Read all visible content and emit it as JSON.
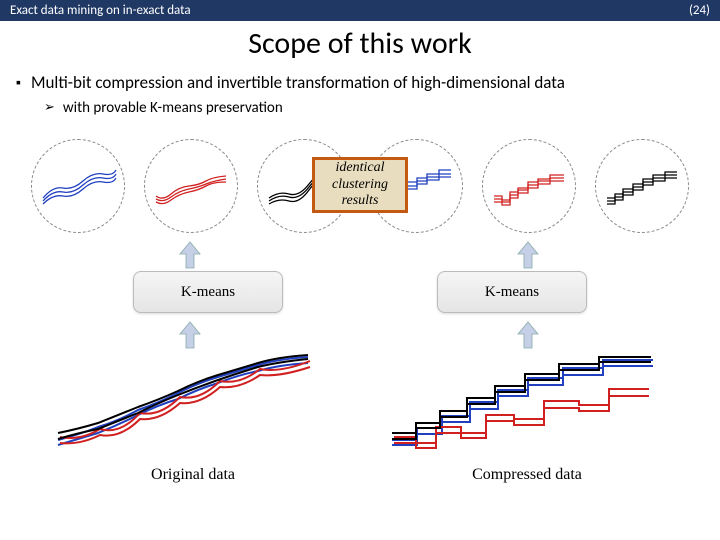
{
  "header": {
    "title": "Exact data mining on in-exact data",
    "page": "(24)"
  },
  "slide_title": "Scope of this work",
  "bullets": {
    "main": "Multi-bit compression and invertible transformation of high-dimensional data",
    "sub": "with provable K-means preservation"
  },
  "identical_label": "identical clustering results",
  "kmeans_label": "K-means",
  "left_data_label": "Original data",
  "right_data_label": "Compressed data",
  "colors": {
    "header_bg": "#203864",
    "box_border": "#c45a11",
    "box_fill": "#e8debf",
    "blue": "#2040c0",
    "red": "#d02020",
    "black": "#000000"
  }
}
